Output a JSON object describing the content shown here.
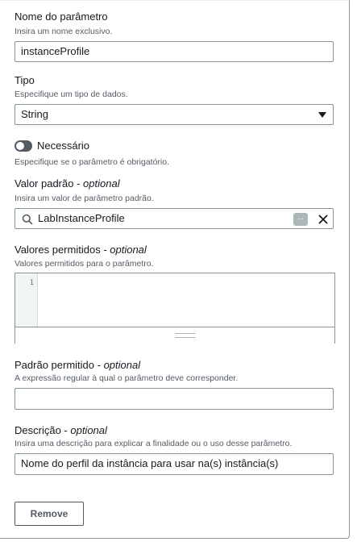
{
  "name_field": {
    "label": "Nome do parâmetro",
    "description": "Insira um nome exclusivo.",
    "value": "instanceProfile"
  },
  "type_field": {
    "label": "Tipo",
    "description": "Especifique um tipo de dados.",
    "selected": "String"
  },
  "required_toggle": {
    "label": "Necessário",
    "description": "Especifique se o parâmetro é obrigatório.",
    "checked": false
  },
  "default_value_field": {
    "label": "Valor padrão",
    "optional": "optional",
    "description": "Insira um valor de parâmetro padrão.",
    "value": "LabInstanceProfile",
    "token_icon": "..."
  },
  "allowed_values_field": {
    "label": "Valores permitidos",
    "optional": "optional",
    "description": "Valores permitidos para o parâmetro.",
    "line_number": "1"
  },
  "allowed_pattern_field": {
    "label": "Padrão permitido",
    "optional": "optional",
    "description": "A expressão regular à qual o parâmetro deve corresponder.",
    "value": ""
  },
  "description_field": {
    "label": "Descrição",
    "optional": "optional",
    "description": "Insira uma descrição para explicar a finalidade ou o uso desse parâmetro.",
    "value": "Nome do perfil da instância para usar na(s) instância(s)"
  },
  "remove_button": {
    "label": "Remove"
  },
  "colors": {
    "border": "#879596",
    "text": "#16191f",
    "muted": "#545b64"
  }
}
